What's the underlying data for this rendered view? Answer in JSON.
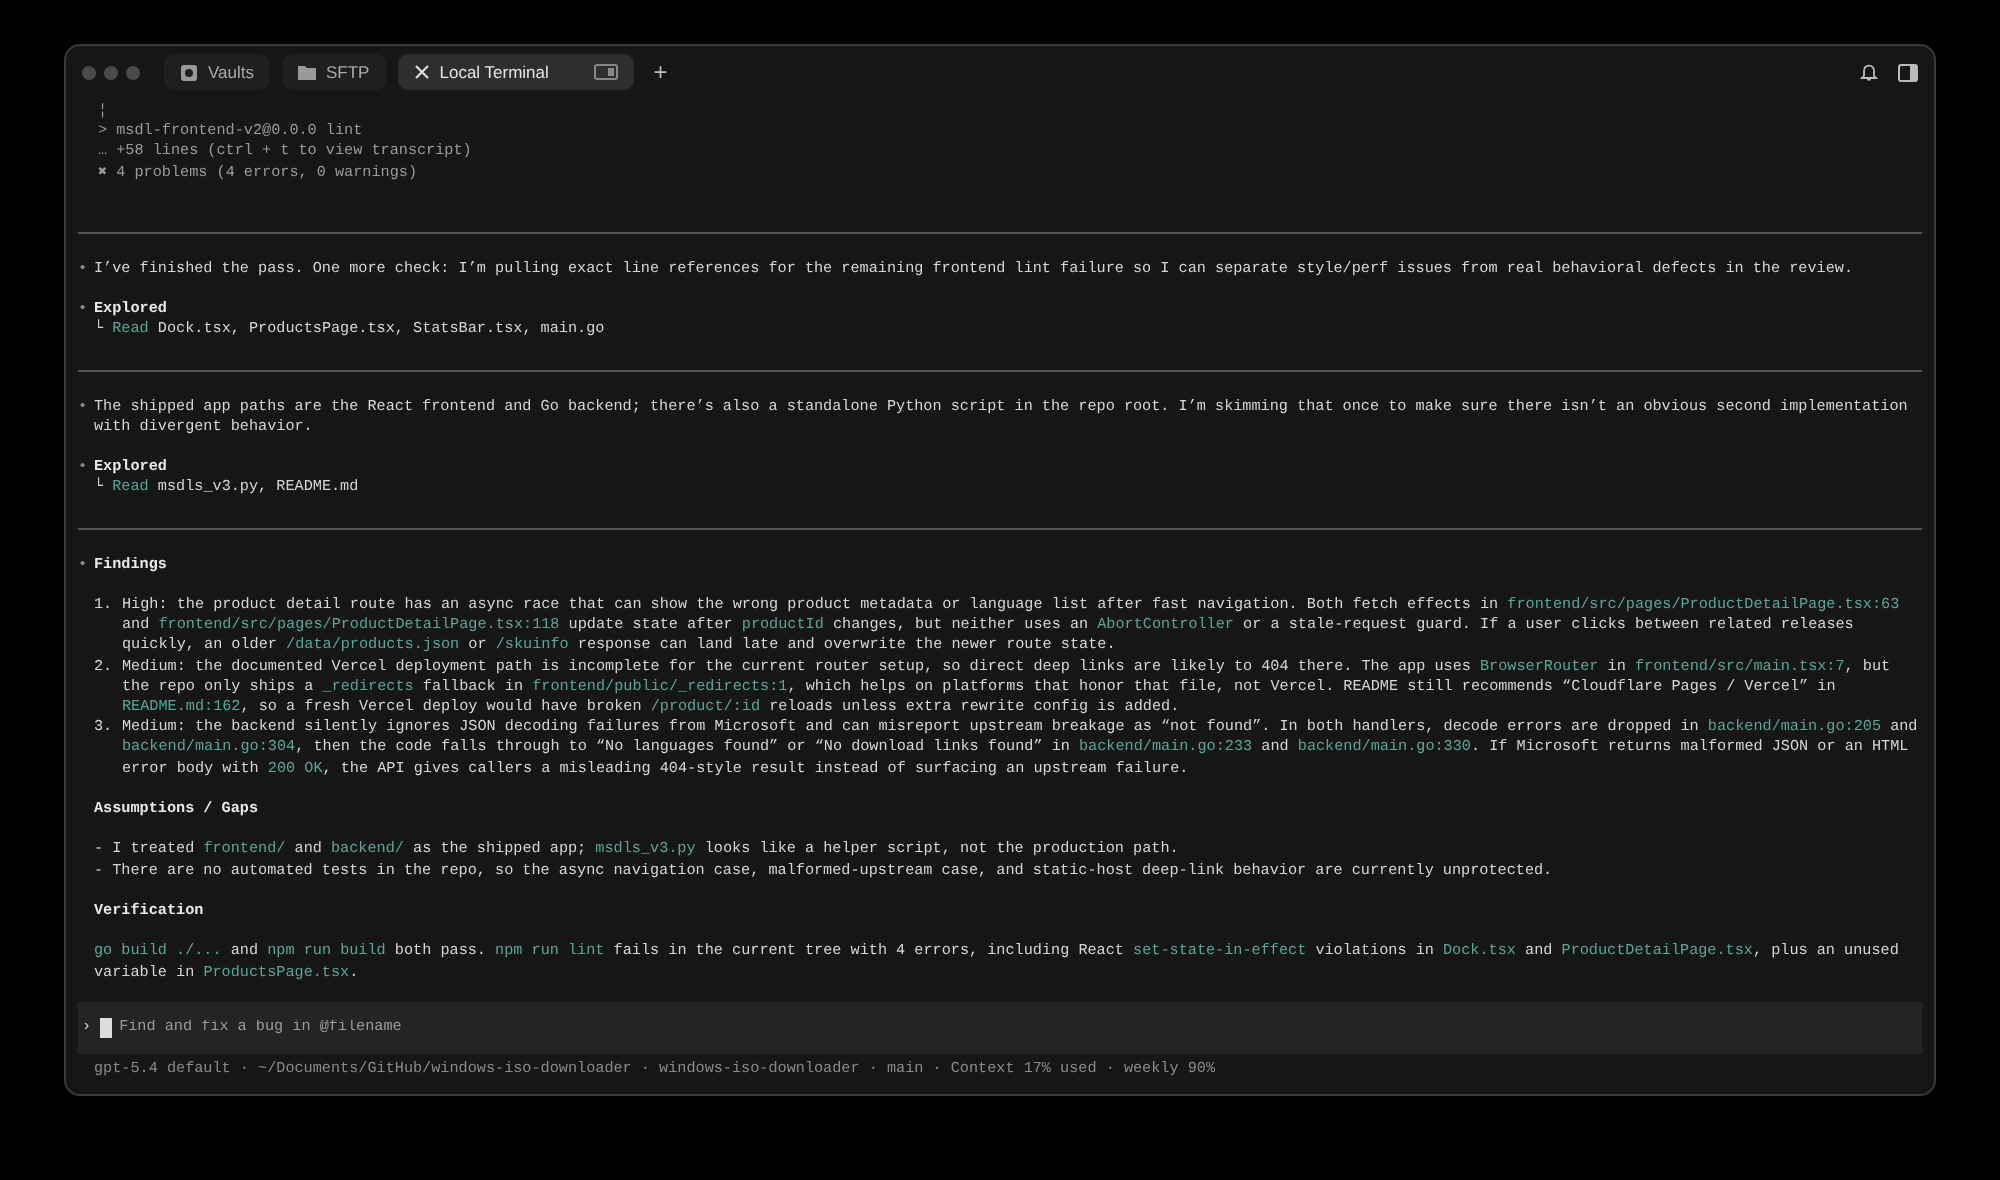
{
  "window": {
    "tabs": [
      {
        "label": "Vaults",
        "selected": false
      },
      {
        "label": "SFTP",
        "selected": false
      },
      {
        "label": "Local Terminal",
        "selected": true
      }
    ],
    "new_tab": "+"
  },
  "sections": [
    {
      "blocks": [
        {
          "kind": "output",
          "lines": [
            "¦",
            "> msdl-frontend-v2@0.0.0 lint",
            "… +58 lines (ctrl + t to view transcript)",
            "✖ 4 problems (4 errors, 0 warnings)"
          ]
        }
      ]
    },
    {
      "blocks": [
        {
          "kind": "message",
          "bullet": "•",
          "parts": [
            {
              "text": "I’ve finished the pass. One more check: I’m pulling exact line references for the remaining frontend lint failure so I can separate style/perf issues from real behavioral defects in the review.",
              "kind": "plain"
            }
          ]
        },
        {
          "kind": "explored",
          "bullet": "•",
          "title": "Explored",
          "parts": [
            {
              "text": "└ ",
              "kind": "plain"
            },
            {
              "text": "Read",
              "kind": "code"
            },
            {
              "text": " Dock.tsx, ProductsPage.tsx, StatsBar.tsx, main.go",
              "kind": "plain"
            }
          ]
        }
      ]
    },
    {
      "blocks": [
        {
          "kind": "message",
          "bullet": "•",
          "parts": [
            {
              "text": "The shipped app paths are the React frontend and Go backend; there’s also a standalone Python script in the repo root. I’m skimming that once to make sure there isn’t an obvious second implementation with divergent behavior.",
              "kind": "plain"
            }
          ]
        },
        {
          "kind": "explored",
          "bullet": "•",
          "title": "Explored",
          "parts": [
            {
              "text": "└ ",
              "kind": "plain"
            },
            {
              "text": "Read",
              "kind": "code"
            },
            {
              "text": " msdls_v3.py, README.md",
              "kind": "plain"
            }
          ]
        }
      ]
    },
    {
      "blocks": [
        {
          "kind": "heading",
          "bullet": "•",
          "title": "Findings"
        },
        {
          "kind": "numbered",
          "items": [
            {
              "number": "1.",
              "parts": [
                {
                  "text": "High: the product detail route has an async race that can show the wrong product metadata or language list after fast navigation. Both fetch effects in ",
                  "kind": "plain"
                },
                {
                  "text": "frontend/src/pages/ProductDetailPage.tsx:63",
                  "kind": "code"
                },
                {
                  "text": " and ",
                  "kind": "plain"
                },
                {
                  "text": "frontend/src/pages/ProductDetailPage.tsx:118",
                  "kind": "code"
                },
                {
                  "text": " update state after ",
                  "kind": "plain"
                },
                {
                  "text": "productId",
                  "kind": "code"
                },
                {
                  "text": " changes, but neither uses an ",
                  "kind": "plain"
                },
                {
                  "text": "AbortController",
                  "kind": "code"
                },
                {
                  "text": " or a stale-request guard. If a user clicks between related releases quickly, an older ",
                  "kind": "plain"
                },
                {
                  "text": "/data/products.json",
                  "kind": "code"
                },
                {
                  "text": " or ",
                  "kind": "plain"
                },
                {
                  "text": "/skuinfo",
                  "kind": "code"
                },
                {
                  "text": " response can land late and overwrite the newer route state.",
                  "kind": "plain"
                }
              ]
            },
            {
              "number": "2.",
              "parts": [
                {
                  "text": "Medium: the documented Vercel deployment path is incomplete for the current router setup, so direct deep links are likely to 404 there. The app uses ",
                  "kind": "plain"
                },
                {
                  "text": "BrowserRouter",
                  "kind": "code"
                },
                {
                  "text": " in ",
                  "kind": "plain"
                },
                {
                  "text": "frontend/src/main.tsx:7",
                  "kind": "code"
                },
                {
                  "text": ", but the repo only ships a ",
                  "kind": "plain"
                },
                {
                  "text": "_redirects",
                  "kind": "code"
                },
                {
                  "text": " fallback in ",
                  "kind": "plain"
                },
                {
                  "text": "frontend/public/_redirects:1",
                  "kind": "code"
                },
                {
                  "text": ", which helps on platforms that honor that file, not Vercel. README still recommends “Cloudflare Pages / Vercel” in ",
                  "kind": "plain"
                },
                {
                  "text": "README.md:162",
                  "kind": "code"
                },
                {
                  "text": ", so a fresh Vercel deploy would have broken ",
                  "kind": "plain"
                },
                {
                  "text": "/product/:id",
                  "kind": "code"
                },
                {
                  "text": " reloads unless extra rewrite config is added.",
                  "kind": "plain"
                }
              ]
            },
            {
              "number": "3.",
              "parts": [
                {
                  "text": "Medium: the backend silently ignores JSON decoding failures from Microsoft and can misreport upstream breakage as “not found”. In both handlers, decode errors are dropped in ",
                  "kind": "plain"
                },
                {
                  "text": "backend/main.go:205",
                  "kind": "code"
                },
                {
                  "text": " and ",
                  "kind": "plain"
                },
                {
                  "text": "backend/main.go:304",
                  "kind": "code"
                },
                {
                  "text": ", then the code falls through to “No languages found” or “No download links found” in ",
                  "kind": "plain"
                },
                {
                  "text": "backend/main.go:233",
                  "kind": "code"
                },
                {
                  "text": " and ",
                  "kind": "plain"
                },
                {
                  "text": "backend/main.go:330",
                  "kind": "code"
                },
                {
                  "text": ". If Microsoft returns malformed JSON or an HTML error body with ",
                  "kind": "plain"
                },
                {
                  "text": "200 OK",
                  "kind": "code"
                },
                {
                  "text": ", the API gives callers a misleading 404-style result instead of surfacing an upstream failure.",
                  "kind": "plain"
                }
              ]
            }
          ]
        },
        {
          "kind": "heading",
          "title": "Assumptions / Gaps"
        },
        {
          "kind": "lines",
          "lines": [
            [
              {
                "text": "- I treated ",
                "kind": "plain"
              },
              {
                "text": "frontend/",
                "kind": "code"
              },
              {
                "text": " and ",
                "kind": "plain"
              },
              {
                "text": "backend/",
                "kind": "code"
              },
              {
                "text": " as the shipped app; ",
                "kind": "plain"
              },
              {
                "text": "msdls_v3.py",
                "kind": "code"
              },
              {
                "text": " looks like a helper script, not the production path.",
                "kind": "plain"
              }
            ],
            [
              {
                "text": "- There are no automated tests in the repo, so the async navigation case, malformed-upstream case, and static-host deep-link behavior are currently unprotected.",
                "kind": "plain"
              }
            ]
          ]
        },
        {
          "kind": "heading",
          "title": "Verification"
        },
        {
          "kind": "paragraph",
          "parts": [
            {
              "text": "go build ./...",
              "kind": "code"
            },
            {
              "text": " and ",
              "kind": "plain"
            },
            {
              "text": "npm run build",
              "kind": "code"
            },
            {
              "text": " both pass. ",
              "kind": "plain"
            },
            {
              "text": "npm run lint",
              "kind": "code"
            },
            {
              "text": " fails in the current tree with 4 errors, including React ",
              "kind": "plain"
            },
            {
              "text": "set-state-in-effect",
              "kind": "code"
            },
            {
              "text": " violations in ",
              "kind": "plain"
            },
            {
              "text": "Dock.tsx",
              "kind": "code"
            },
            {
              "text": " and ",
              "kind": "plain"
            },
            {
              "text": "ProductDetailPage.tsx",
              "kind": "code"
            },
            {
              "text": ", plus an unused variable in ",
              "kind": "plain"
            },
            {
              "text": "ProductsPage.tsx",
              "kind": "code"
            },
            {
              "text": ".",
              "kind": "plain"
            }
          ]
        }
      ]
    }
  ],
  "composer": {
    "prompt": "›",
    "placeholder": "Find and fix a bug in @filename"
  },
  "status_bar": "gpt-5.4 default · ~/Documents/GitHub/windows-iso-downloader · windows-iso-downloader · main · Context 17% used · weekly 90%"
}
